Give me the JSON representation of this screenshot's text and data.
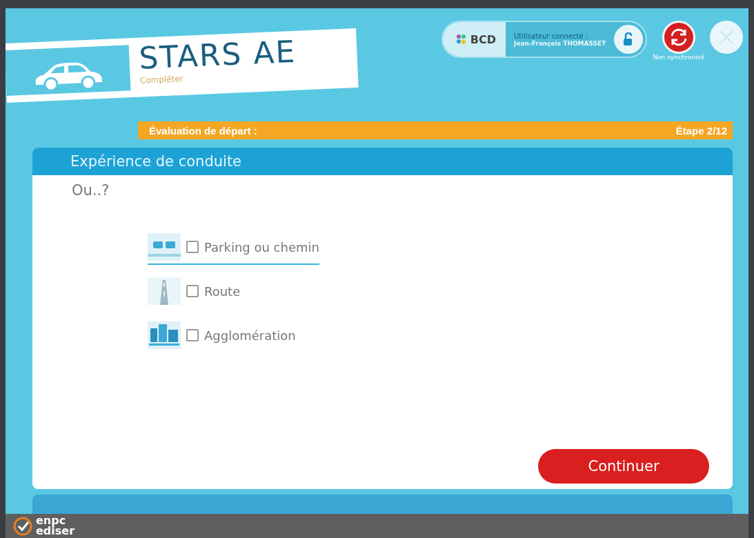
{
  "app": {
    "title": "STARS AE",
    "subtitle": "Compléter"
  },
  "account": {
    "brand": "BCD",
    "user_label": "Utilisateur connecté :",
    "user_name": "Jean-François THOMASSET",
    "sync_label": "Non synchronisé"
  },
  "progress": {
    "title": "Évaluation de départ :",
    "step": "Étape 2/12"
  },
  "card": {
    "title": "Expérience de conduite",
    "question": "Ou..?"
  },
  "options": [
    {
      "label": "Parking ou chemin",
      "selected": true,
      "checked": false,
      "kind": "parking"
    },
    {
      "label": "Route",
      "selected": false,
      "checked": false,
      "kind": "road"
    },
    {
      "label": "Agglomération",
      "selected": false,
      "checked": false,
      "kind": "city"
    }
  ],
  "continue_button": "Continuer",
  "footer": {
    "logo_top": "enpc",
    "logo_bottom": "ediser"
  }
}
